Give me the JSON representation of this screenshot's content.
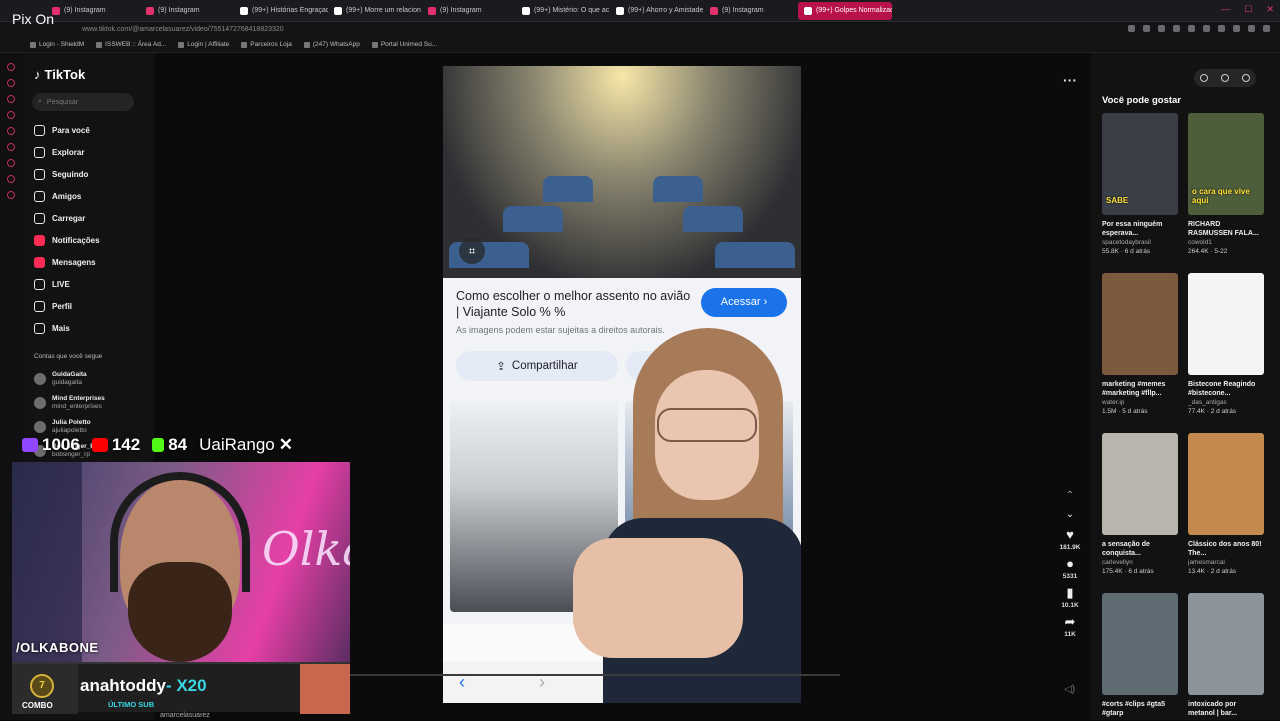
{
  "browser": {
    "tabs": [
      {
        "label": "(9) Instagram",
        "color": "#e1306c"
      },
      {
        "label": "(9) Instagram",
        "color": "#e1306c"
      },
      {
        "label": "(99+) Histórias Engraçad",
        "color": "#ffffff"
      },
      {
        "label": "(99+) Morre um relacion",
        "color": "#ffffff"
      },
      {
        "label": "(9) Instagram",
        "color": "#e1306c"
      },
      {
        "label": "(99+) Mistério: O que ac",
        "color": "#ffffff"
      },
      {
        "label": "(99+) Ahorro y Amistade",
        "color": "#ffffff"
      },
      {
        "label": "(9) Instagram",
        "color": "#e1306c"
      },
      {
        "label": "(99+) Golpes Normalizad",
        "color": "#ffffff",
        "active": true
      }
    ],
    "url": "www.tiktok.com/@amarcelasuarez/video/7551472768418823320",
    "bookmarks": [
      "Login - ShieldM",
      "ISSWEB :: Área Ad...",
      "Login | Affiliate",
      "Parceiros Loja",
      "(247) WhatsApp",
      "Portal Unimed Su..."
    ]
  },
  "overlay_title": "Pix On",
  "tiktok": {
    "logo": "TikTok",
    "search_placeholder": "Pesquisar",
    "nav": [
      {
        "label": "Para você",
        "icon": "home-icon"
      },
      {
        "label": "Explorar",
        "icon": "compass-icon"
      },
      {
        "label": "Seguindo",
        "icon": "following-icon"
      },
      {
        "label": "Amigos",
        "icon": "friends-icon"
      },
      {
        "label": "Carregar",
        "icon": "upload-icon"
      },
      {
        "label": "Notificações",
        "icon": "notification-icon"
      },
      {
        "label": "Mensagens",
        "icon": "message-icon"
      },
      {
        "label": "LIVE",
        "icon": "live-icon"
      },
      {
        "label": "Perfil",
        "icon": "profile-icon"
      },
      {
        "label": "Mais",
        "icon": "more-icon"
      }
    ],
    "following_title": "Contas que você segue",
    "following": [
      {
        "name": "GuidaGaita",
        "handle": "guidagaita"
      },
      {
        "name": "Mind Enterprises",
        "handle": "mind_enterprises"
      },
      {
        "name": "Julia Poletto",
        "handle": "ajuliapoletto"
      },
      {
        "name": "Bob Singer_Rp",
        "handle": "bobsinger_rp"
      }
    ]
  },
  "stream": {
    "twitch_count": "1006",
    "youtube_count": "142",
    "kick_count": "84",
    "brand": "UaiRango",
    "cam_tag": "/OLKABONE",
    "combo_count": "7",
    "combo_label": "COMBO",
    "sub_name": "anahtoddy",
    "sub_multiplier": "- X20",
    "sub_label": "ÚLTIMO SUB",
    "bottom_name": "amarcelasuarez",
    "neon_text": "Olka"
  },
  "video": {
    "result_title": "Como escolher o melhor assento no avião | Viajante Solo % %",
    "access_button": "Acessar",
    "rights_text": "As imagens podem estar sujeitas a direitos autorais.",
    "share_button": "Compartilhar",
    "likes": "181.9K",
    "comments": "5331",
    "saves": "10.1K",
    "shares": "11K"
  },
  "suggestions": {
    "title": "Você pode gostar",
    "cards": [
      {
        "title": "Por essa ninguém esperava...",
        "author": "spacetodaybrasil",
        "meta": "55.8K · 6 d atrás",
        "overlay": "SABE",
        "bg": "#3a3f47"
      },
      {
        "title": "RICHARD RASMUSSEN FALA...",
        "author": "cowold1",
        "meta": "264.4K · 5-22",
        "overlay": "o cara que vive aqui",
        "bg": "#4d5e3a"
      },
      {
        "title": "marketing #memes #marketing #fllp...",
        "author": "water.ip",
        "meta": "1.5M · 5 d atrás",
        "overlay": "",
        "bg": "#7c5a3e"
      },
      {
        "title": "Bistecone Reagindo #bistecone...",
        "author": "_das_antigas",
        "meta": "77.4K · 2 d atrás",
        "overlay": "",
        "bg": "#f4f4f4"
      },
      {
        "title": "a sensação de conquista...",
        "author": "carlevellyn",
        "meta": "175.4K · 6 d atrás",
        "overlay": "",
        "bg": "#b9b5ad"
      },
      {
        "title": "Clássico dos anos 80! The...",
        "author": "jamesmarcal",
        "meta": "13.4K · 2 d atrás",
        "overlay": "",
        "bg": "#c28a4c"
      },
      {
        "title": "#corts #clips #gta5 #gtarp",
        "author": "",
        "meta": "",
        "overlay": "",
        "bg": "#5f6b73"
      },
      {
        "title": "intoxicado por metanol | bar...",
        "author": "",
        "meta": "",
        "overlay": "",
        "bg": "#8d939a"
      }
    ]
  }
}
